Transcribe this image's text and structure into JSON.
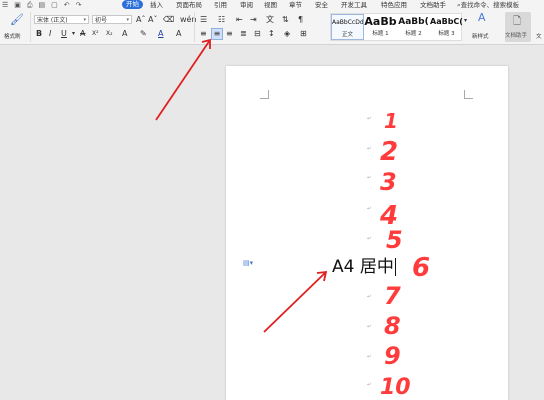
{
  "tabs": {
    "start": "开始",
    "insert": "插入",
    "layout": "页面布局",
    "reference": "引用",
    "review": "审阅",
    "view": "视图",
    "chapter": "章节",
    "security": "安全",
    "dev_tools": "开发工具",
    "features": "特色应用",
    "doc_assistant": "文档助手",
    "search": "查找命令、搜索模板"
  },
  "toolbar": {
    "format_painter": "格式刷",
    "font_name": "宋体 (正文)",
    "font_size": "初号",
    "bold": "B",
    "italic": "I",
    "underline": "U",
    "font_color": "A",
    "new_style": "新样式",
    "doc_assistant": "文档助手",
    "more_label": "文"
  },
  "styles": [
    {
      "preview": "AaBbCcDd",
      "name": "正文"
    },
    {
      "preview": "AaBb",
      "name": "标题 1"
    },
    {
      "preview": "AaBb(",
      "name": "标题 2"
    },
    {
      "preview": "AaBbC(",
      "name": "标题 3"
    }
  ],
  "document": {
    "text": "A4 居中"
  },
  "annotations": {
    "color": "#ff3b3b",
    "numbers": [
      "1",
      "2",
      "3",
      "4",
      "5",
      "6",
      "7",
      "8",
      "9",
      "10"
    ]
  }
}
